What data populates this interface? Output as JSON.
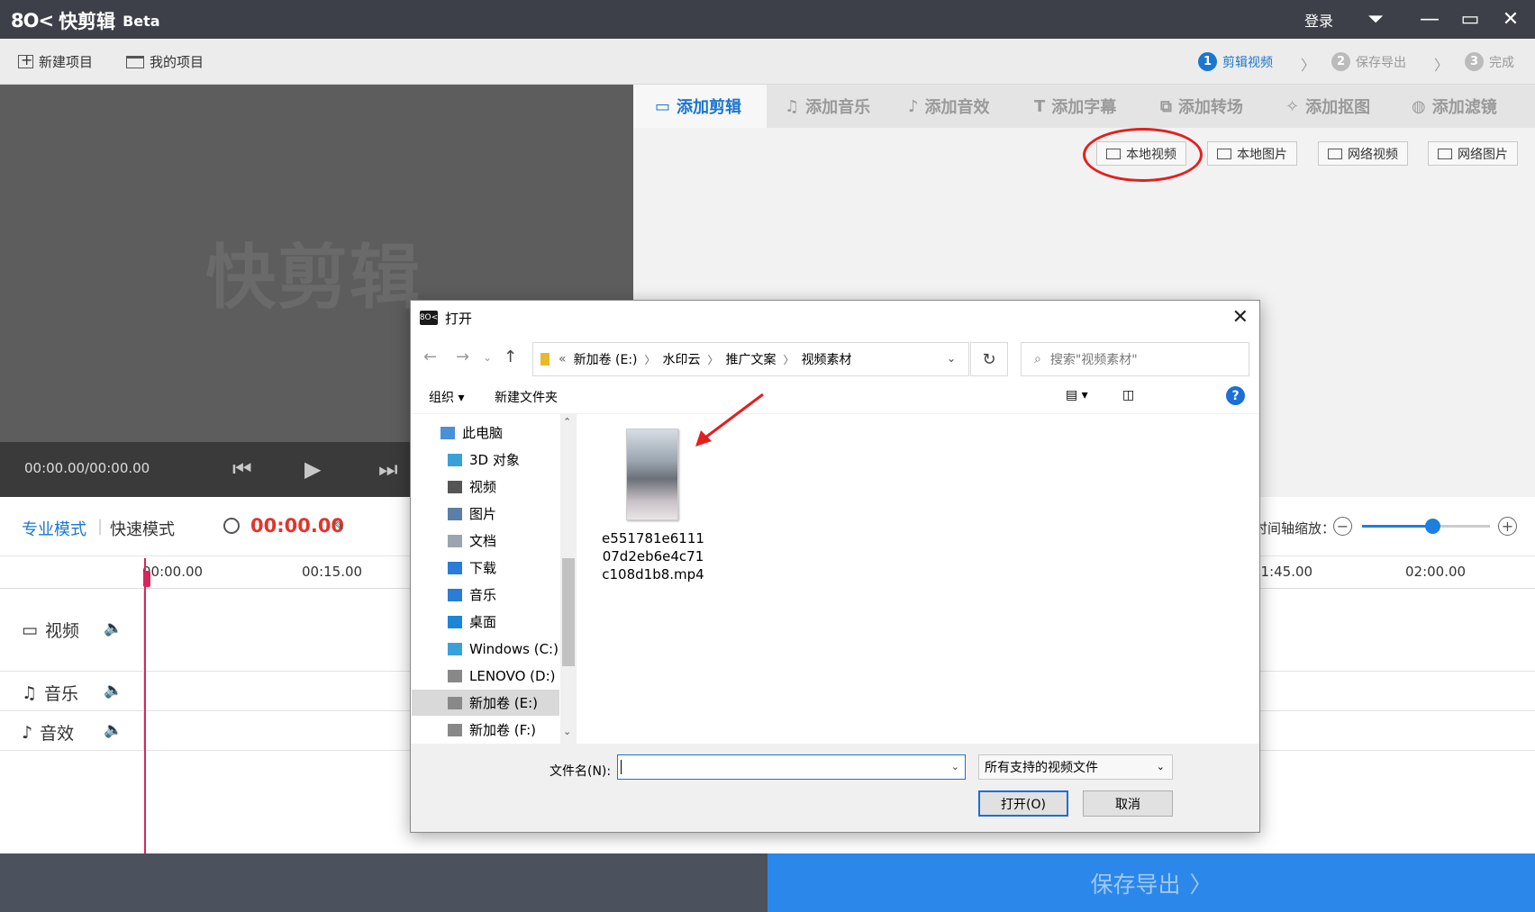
{
  "app": {
    "logo_mark": "8O<",
    "name": "快剪辑",
    "beta": "Beta"
  },
  "titlebar": {
    "login": "登录",
    "menu_icon": "dropdown-menu-icon",
    "minimize_icon": "minimize-icon",
    "maximize_icon": "maximize-icon",
    "close_icon": "close-icon"
  },
  "toolbar": {
    "new_project": "新建项目",
    "my_projects": "我的项目"
  },
  "steps": [
    {
      "num": "1",
      "label": "剪辑视频",
      "active": true
    },
    {
      "num": "2",
      "label": "保存导出",
      "active": false
    },
    {
      "num": "3",
      "label": "完成",
      "active": false
    }
  ],
  "preview": {
    "watermark": "快剪辑",
    "timecode": "00:00.00/00:00.00"
  },
  "tabs": [
    {
      "label": "添加剪辑",
      "icon": "video-camera-icon",
      "glyph": "▭",
      "active": true
    },
    {
      "label": "添加音乐",
      "icon": "music-note-icon",
      "glyph": "♫",
      "active": false
    },
    {
      "label": "添加音效",
      "icon": "sound-effect-icon",
      "glyph": "♪",
      "active": false
    },
    {
      "label": "添加字幕",
      "icon": "text-icon",
      "glyph": "T",
      "active": false
    },
    {
      "label": "添加转场",
      "icon": "transition-icon",
      "glyph": "⧉",
      "active": false
    },
    {
      "label": "添加抠图",
      "icon": "cutout-icon",
      "glyph": "✧",
      "active": false
    },
    {
      "label": "添加滤镜",
      "icon": "filter-icon",
      "glyph": "◍",
      "active": false
    }
  ],
  "sources": [
    "本地视频",
    "本地图片",
    "网络视频",
    "网络图片"
  ],
  "timeline": {
    "mode_pro": "专业模式",
    "mode_quick": "快速模式",
    "time": "00:00.00",
    "zoom_label": "时间轴缩放：",
    "zoom_level": 0.55,
    "ticks": [
      "00:00.00",
      "00:15.00",
      "01:45.00",
      "02:00.00"
    ],
    "tracks": [
      {
        "label": "视频",
        "icon": "video-track-icon"
      },
      {
        "label": "音乐",
        "icon": "music-track-icon"
      },
      {
        "label": "音效",
        "icon": "sound-track-icon"
      }
    ]
  },
  "export": {
    "label": "保存导出"
  },
  "dialog": {
    "title": "打开",
    "breadcrumb": [
      "新加卷 (E:)",
      "水印云",
      "推广文案",
      "视频素材"
    ],
    "search_placeholder": "搜索\"视频素材\"",
    "organize": "组织",
    "new_folder": "新建文件夹",
    "tree": [
      {
        "label": "此电脑",
        "icon": "computer-icon",
        "color": "#4a90d9",
        "selected": false,
        "indent": 0
      },
      {
        "label": "3D 对象",
        "icon": "3d-objects-icon",
        "color": "#3aa0d8",
        "selected": false,
        "indent": 1
      },
      {
        "label": "视频",
        "icon": "videos-folder-icon",
        "color": "#555",
        "selected": false,
        "indent": 1
      },
      {
        "label": "图片",
        "icon": "pictures-folder-icon",
        "color": "#5a7fa8",
        "selected": false,
        "indent": 1
      },
      {
        "label": "文档",
        "icon": "documents-folder-icon",
        "color": "#9aa5b1",
        "selected": false,
        "indent": 1
      },
      {
        "label": "下载",
        "icon": "downloads-folder-icon",
        "color": "#2b7bd8",
        "selected": false,
        "indent": 1
      },
      {
        "label": "音乐",
        "icon": "music-folder-icon",
        "color": "#2b7bd8",
        "selected": false,
        "indent": 1
      },
      {
        "label": "桌面",
        "icon": "desktop-folder-icon",
        "color": "#1b86d6",
        "selected": false,
        "indent": 1
      },
      {
        "label": "Windows (C:)",
        "icon": "windows-drive-icon",
        "color": "#3aa0d8",
        "selected": false,
        "indent": 1
      },
      {
        "label": "LENOVO (D:)",
        "icon": "drive-icon",
        "color": "#888",
        "selected": false,
        "indent": 1
      },
      {
        "label": "新加卷 (E:)",
        "icon": "drive-icon",
        "color": "#888",
        "selected": true,
        "indent": 1
      },
      {
        "label": "新加卷 (F:)",
        "icon": "drive-icon",
        "color": "#888",
        "selected": false,
        "indent": 1
      }
    ],
    "file": {
      "name": "e551781e611107d2eb6e4c71c108d1b8.mp4",
      "lines": [
        "e551781e6111",
        "07d2eb6e4c71",
        "c108d1b8.mp4"
      ]
    },
    "filename_label": "文件名(N):",
    "filename_value": "",
    "filetype": "所有支持的视频文件",
    "open_btn": "打开(O)",
    "cancel_btn": "取消"
  },
  "colors": {
    "accent": "#1b76cf",
    "export_bg": "#2b88ea",
    "playhead": "#d6265b",
    "annotation": "#e41f1f"
  }
}
